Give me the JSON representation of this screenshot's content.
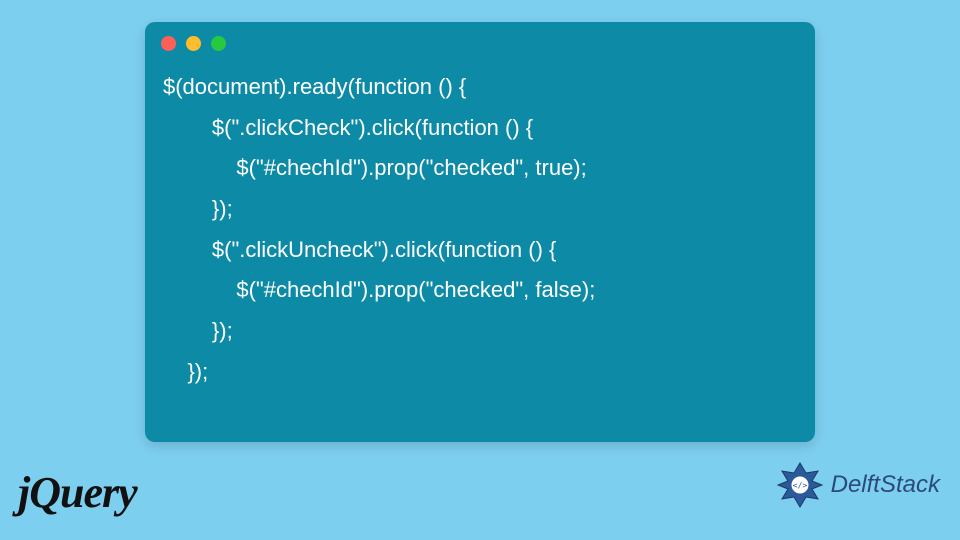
{
  "code": {
    "lines": [
      "$(document).ready(function () {",
      "        $(\".clickCheck\").click(function () {",
      "            $(\"#chechId\").prop(\"checked\", true);",
      "        });",
      "        $(\".clickUncheck\").click(function () {",
      "            $(\"#chechId\").prop(\"checked\", false);",
      "        });",
      "    });"
    ]
  },
  "logos": {
    "jquery": "jQuery",
    "delftstack": "DelftStack"
  },
  "colors": {
    "background": "#7dcff0",
    "window": "#0d8aa6",
    "dot_red": "#ff5f56",
    "dot_yellow": "#ffbd2e",
    "dot_green": "#27c93f"
  }
}
